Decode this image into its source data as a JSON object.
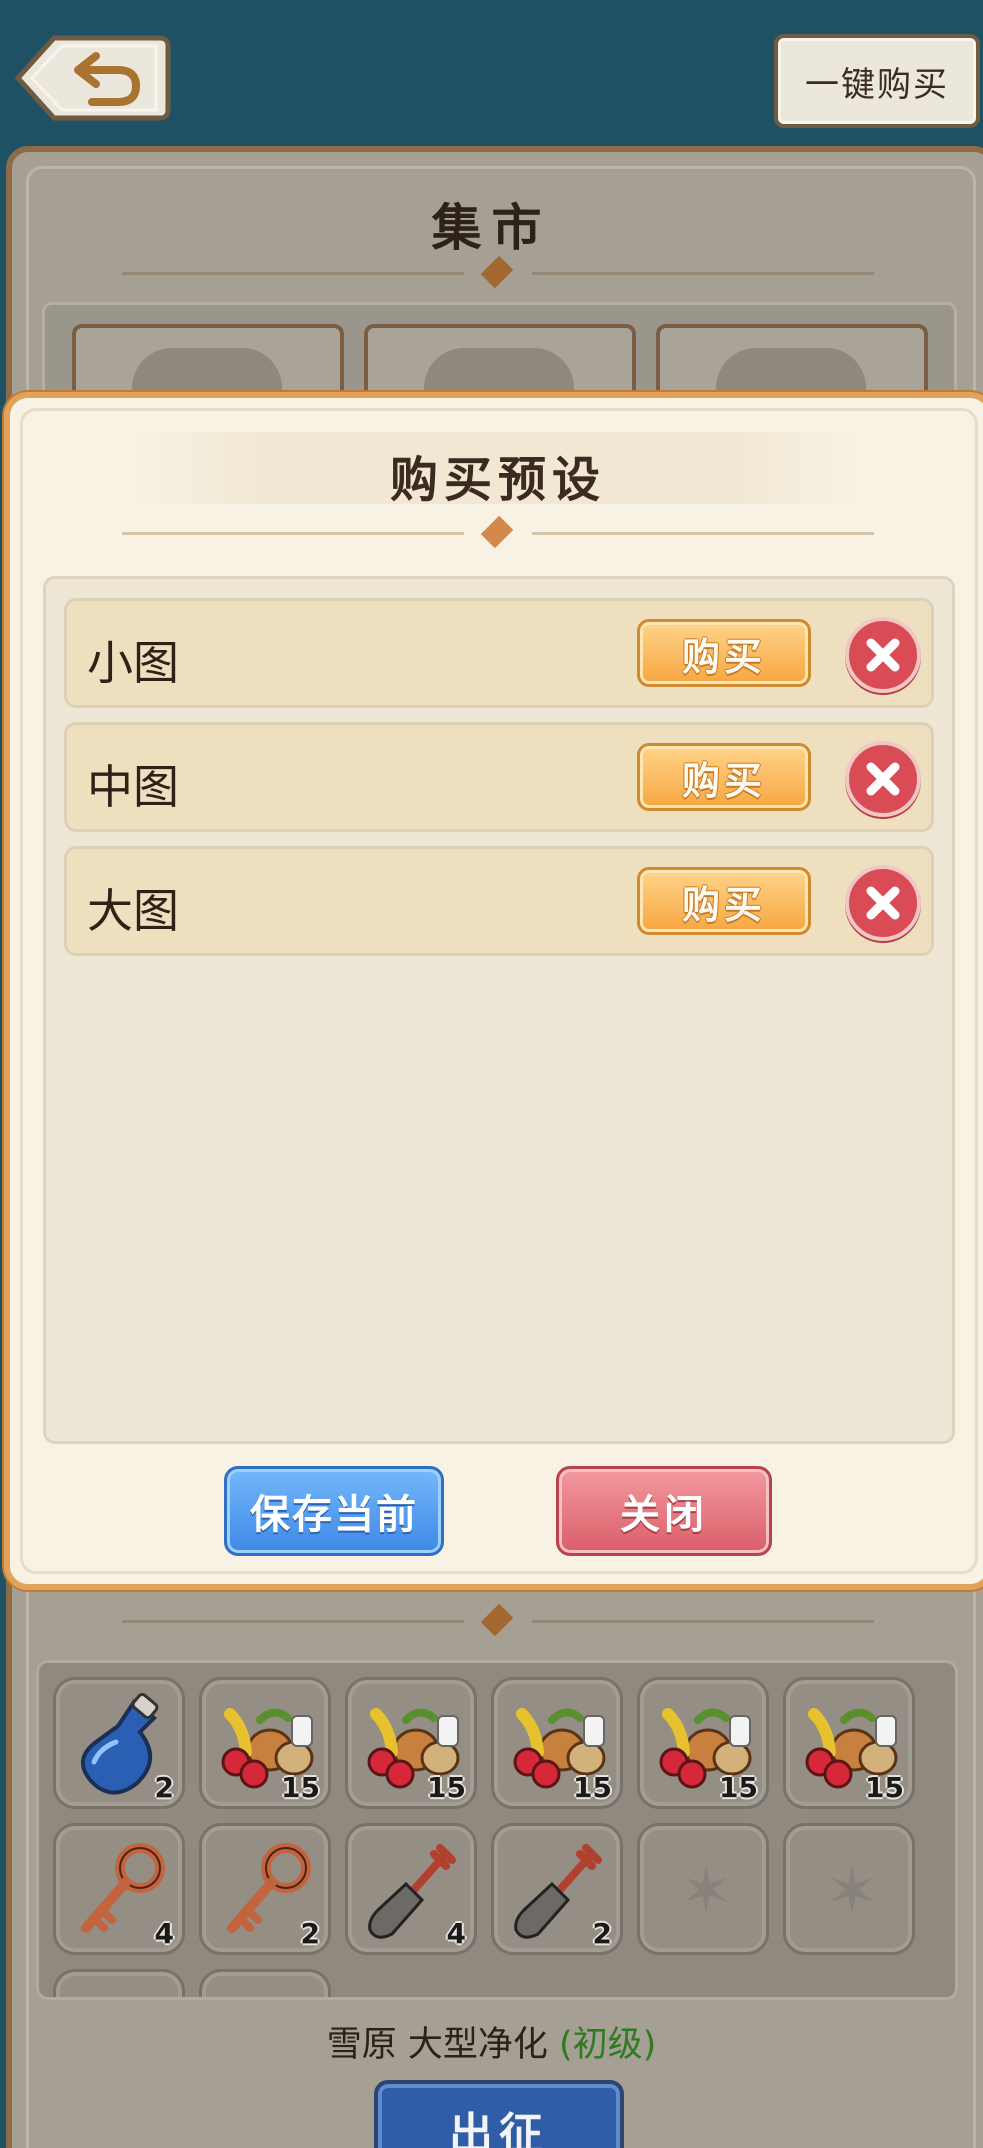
{
  "topbar": {
    "back_icon": "undo-arrow-icon",
    "buy_all_label": "一键购买"
  },
  "market": {
    "title": "集市",
    "stage_name": "雪原 大型净化",
    "stage_level": "(初级)",
    "go_label": "出征"
  },
  "inventory": {
    "items": [
      {
        "icon": "blue-potion-icon",
        "count": "2"
      },
      {
        "icon": "food-basket-icon",
        "count": "15"
      },
      {
        "icon": "food-basket-icon",
        "count": "15"
      },
      {
        "icon": "food-basket-icon",
        "count": "15"
      },
      {
        "icon": "food-basket-icon",
        "count": "15"
      },
      {
        "icon": "food-basket-icon",
        "count": "15"
      },
      {
        "icon": "key-icon",
        "count": "4"
      },
      {
        "icon": "key-icon",
        "count": "2"
      },
      {
        "icon": "shovel-icon",
        "count": "4"
      },
      {
        "icon": "shovel-icon",
        "count": "2"
      }
    ]
  },
  "modal": {
    "title": "购买预设",
    "presets": [
      {
        "name": "小图",
        "buy_label": "购买"
      },
      {
        "name": "中图",
        "buy_label": "购买"
      },
      {
        "name": "大图",
        "buy_label": "购买"
      }
    ],
    "save_label": "保存当前",
    "close_label": "关闭"
  },
  "colors": {
    "background": "#1d5163",
    "buy_button": "#f7a640",
    "save_button": "#3e88e6",
    "close_button": "#db5d68",
    "delete_button": "#d94b55"
  }
}
